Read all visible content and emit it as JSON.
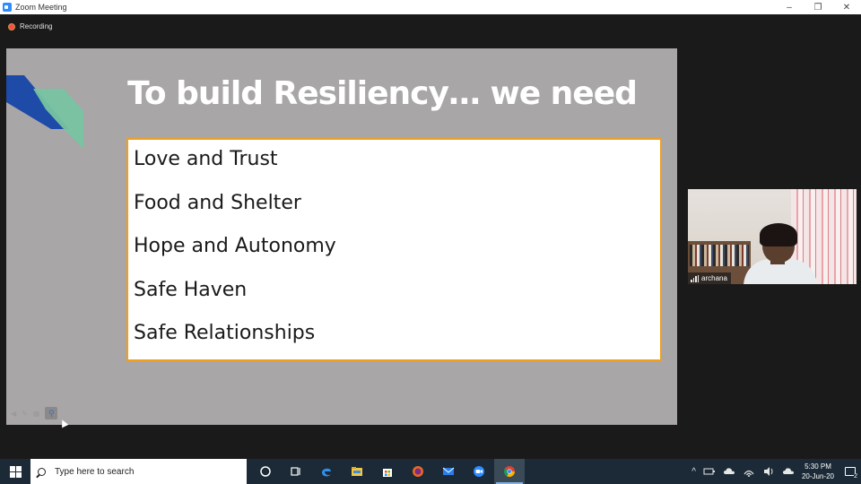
{
  "window": {
    "title": "Zoom Meeting",
    "controls": {
      "minimize": "–",
      "restore": "❐",
      "close": "✕"
    }
  },
  "meeting": {
    "recording_label": "Recording",
    "slide": {
      "title": "To build  Resiliency…  we need",
      "items": [
        "Love and Trust",
        "Food and Shelter",
        "Hope and Autonomy",
        "Safe Haven",
        "Safe Relationships"
      ],
      "colors": {
        "background": "#a9a6a8",
        "box_border": "#f0a020",
        "deco_blue": "#1e4aa8",
        "deco_green": "#77c3a0"
      }
    },
    "participant": {
      "name": "archana"
    }
  },
  "taskbar": {
    "search_placeholder": "Type here to search",
    "apps": [
      "cortana-icon",
      "task-view-icon",
      "edge-icon",
      "file-explorer-icon",
      "store-icon",
      "firefox-icon",
      "mail-icon",
      "zoom-icon",
      "chrome-icon"
    ],
    "tray": {
      "chevron": "^"
    },
    "clock": {
      "time": "5:30 PM",
      "date": "20-Jun-20"
    },
    "notifications_count": "2"
  }
}
